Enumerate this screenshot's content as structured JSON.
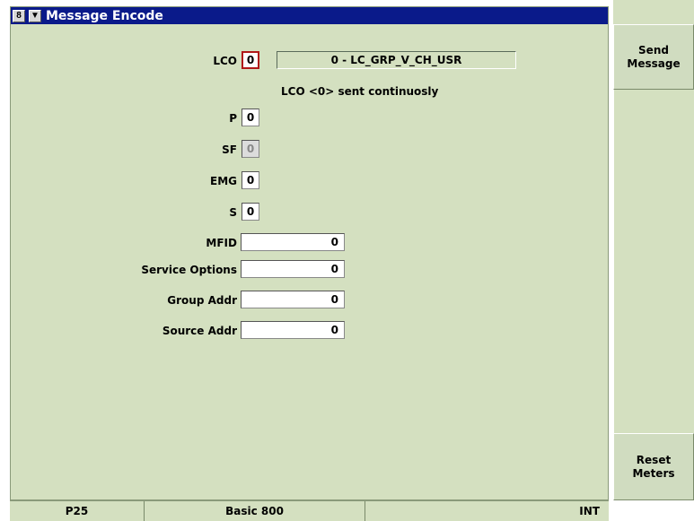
{
  "window": {
    "title": "Message Encode",
    "icon_glyph": "8",
    "menu_glyph": "▼"
  },
  "lco": {
    "label": "LCO",
    "value": "0",
    "name": "0 - LC_GRP_V_CH_USR",
    "status": "LCO <0> sent continuosly"
  },
  "fields": {
    "p": {
      "label": "P",
      "value": "0"
    },
    "sf": {
      "label": "SF",
      "value": "0"
    },
    "emg": {
      "label": "EMG",
      "value": "0"
    },
    "s": {
      "label": "S",
      "value": "0"
    },
    "mfid": {
      "label": "MFID",
      "value": "0"
    },
    "service_options": {
      "label": "Service Options",
      "value": "0"
    },
    "group_addr": {
      "label": "Group Addr",
      "value": "0"
    },
    "source_addr": {
      "label": "Source Addr",
      "value": "0"
    }
  },
  "side_buttons": {
    "send_line1": "Send",
    "send_line2": "Message",
    "reset_line1": "Reset",
    "reset_line2": "Meters"
  },
  "status": {
    "mode": "P25",
    "system": "Basic 800",
    "reference": "INT"
  },
  "colors": {
    "panel_bg": "#d4e0c0",
    "title_bar": "#0a1a8a",
    "active_border": "#b01818"
  }
}
